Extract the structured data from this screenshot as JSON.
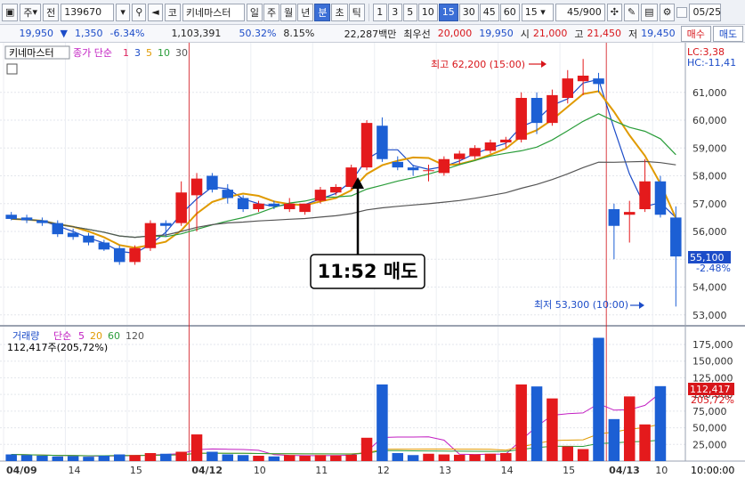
{
  "toolbar": {
    "market_select": "주",
    "prev_label": "전",
    "code": "139670",
    "exchange_label": "코",
    "stock_name": "키네마스터",
    "periods": [
      "일",
      "주",
      "월",
      "년",
      "분",
      "초",
      "틱"
    ],
    "active_period": "분",
    "intervals": [
      "1",
      "3",
      "5",
      "10",
      "15",
      "30",
      "45",
      "60"
    ],
    "active_interval": "15",
    "interval_select": "15",
    "count": "45/900",
    "date": "05/25"
  },
  "quote": {
    "price": "19,950",
    "change": "1,350",
    "change_pct": "-6.34%",
    "volume": "1,103,391",
    "vol_ratio": "50.32%",
    "turnover": "8.15%",
    "amount": "22,287백만",
    "pref_label": "최우선",
    "ask": "20,000",
    "bid": "19,950",
    "open_label": "시",
    "open": "21,000",
    "high_label": "고",
    "high": "21,450",
    "low_label": "저",
    "low": "19,450",
    "buy_button": "매수",
    "sell_button": "매도"
  },
  "price_panel": {
    "stock_label": "키네마스터",
    "ma_title": "종가 단순",
    "ma_periods": [
      "1",
      "3",
      "5",
      "10",
      "30"
    ],
    "ma_colors": [
      "#e0245e",
      "#1c4cc8",
      "#e09a00",
      "#2a9d3a",
      "#555555"
    ],
    "lc_label": "LC:3,38",
    "hc_label": "HC:-11,41",
    "high_annot": "최고 62,200 (15:00)",
    "low_annot": "최저 53,300 (10:00)",
    "callout": "11:52 매도",
    "current_price_tag": "55,100",
    "current_pct_tag": "-2.48%",
    "y_ticks": [
      "61,000",
      "60,000",
      "59,000",
      "58,000",
      "57,000",
      "56,000",
      "54,000",
      "53,000"
    ]
  },
  "volume_panel": {
    "title": "거래량",
    "ma_title": "단순",
    "ma_periods": [
      "5",
      "20",
      "60",
      "120"
    ],
    "ma_colors": [
      "#c21ec2",
      "#e09a00",
      "#2a9d3a",
      "#555555"
    ],
    "info": "112,417주(205,72%)",
    "current_tag": "112,417",
    "current_pct": "205,72%",
    "y_ticks": [
      "175,000",
      "150,000",
      "125,000",
      "100,000",
      "75,000",
      "50,000",
      "25,000"
    ]
  },
  "x_axis": {
    "labels": [
      "04/09",
      "14",
      "15",
      "04/12",
      "10",
      "11",
      "12",
      "13",
      "14",
      "15",
      "04/13",
      "10"
    ],
    "corner": "10:00:00"
  },
  "chart_data": {
    "type": "candlestick",
    "price_range": [
      52800,
      62400
    ],
    "volume_range": [
      0,
      195000
    ],
    "candles": [
      {
        "o": 56600,
        "h": 56700,
        "l": 56400,
        "c": 56450
      },
      {
        "o": 56500,
        "h": 56600,
        "l": 56300,
        "c": 56400
      },
      {
        "o": 56400,
        "h": 56500,
        "l": 56200,
        "c": 56300
      },
      {
        "o": 56300,
        "h": 56400,
        "l": 55800,
        "c": 55900
      },
      {
        "o": 55950,
        "h": 56100,
        "l": 55700,
        "c": 55800
      },
      {
        "o": 55850,
        "h": 55950,
        "l": 55500,
        "c": 55600
      },
      {
        "o": 55600,
        "h": 55700,
        "l": 55300,
        "c": 55350
      },
      {
        "o": 55400,
        "h": 55500,
        "l": 54800,
        "c": 54900
      },
      {
        "o": 54900,
        "h": 55500,
        "l": 54800,
        "c": 55400
      },
      {
        "o": 55400,
        "h": 56400,
        "l": 55300,
        "c": 56300
      },
      {
        "o": 56300,
        "h": 56400,
        "l": 55800,
        "c": 56200
      },
      {
        "o": 56300,
        "h": 57800,
        "l": 56200,
        "c": 57400
      },
      {
        "o": 57300,
        "h": 58100,
        "l": 56000,
        "c": 57900
      },
      {
        "o": 58000,
        "h": 58100,
        "l": 57400,
        "c": 57500
      },
      {
        "o": 57500,
        "h": 57700,
        "l": 57000,
        "c": 57200
      },
      {
        "o": 57200,
        "h": 57300,
        "l": 56700,
        "c": 56800
      },
      {
        "o": 56800,
        "h": 57100,
        "l": 56700,
        "c": 57000
      },
      {
        "o": 57000,
        "h": 57100,
        "l": 56800,
        "c": 56900
      },
      {
        "o": 56800,
        "h": 57200,
        "l": 56700,
        "c": 57000
      },
      {
        "o": 56700,
        "h": 57000,
        "l": 56600,
        "c": 57000
      },
      {
        "o": 57100,
        "h": 57600,
        "l": 57000,
        "c": 57500
      },
      {
        "o": 57400,
        "h": 57700,
        "l": 57300,
        "c": 57600
      },
      {
        "o": 57600,
        "h": 58400,
        "l": 57500,
        "c": 58300
      },
      {
        "o": 58300,
        "h": 60000,
        "l": 58200,
        "c": 59900
      },
      {
        "o": 59800,
        "h": 60100,
        "l": 58500,
        "c": 58600
      },
      {
        "o": 58500,
        "h": 58700,
        "l": 58200,
        "c": 58300
      },
      {
        "o": 58300,
        "h": 58400,
        "l": 58000,
        "c": 58200
      },
      {
        "o": 58200,
        "h": 58400,
        "l": 57800,
        "c": 58200
      },
      {
        "o": 58100,
        "h": 58700,
        "l": 58000,
        "c": 58600
      },
      {
        "o": 58600,
        "h": 58900,
        "l": 58400,
        "c": 58800
      },
      {
        "o": 58700,
        "h": 59100,
        "l": 58600,
        "c": 59000
      },
      {
        "o": 58900,
        "h": 59300,
        "l": 58800,
        "c": 59200
      },
      {
        "o": 59200,
        "h": 59400,
        "l": 59000,
        "c": 59300
      },
      {
        "o": 59300,
        "h": 61000,
        "l": 59200,
        "c": 60800
      },
      {
        "o": 60800,
        "h": 61000,
        "l": 59500,
        "c": 59900
      },
      {
        "o": 59900,
        "h": 61100,
        "l": 59800,
        "c": 60900
      },
      {
        "o": 60800,
        "h": 61800,
        "l": 60600,
        "c": 61500
      },
      {
        "o": 61400,
        "h": 62200,
        "l": 60900,
        "c": 61600
      },
      {
        "o": 61500,
        "h": 61700,
        "l": 61000,
        "c": 61300
      },
      {
        "o": 56800,
        "h": 57000,
        "l": 55000,
        "c": 56200
      },
      {
        "o": 56600,
        "h": 57100,
        "l": 55600,
        "c": 56700
      },
      {
        "o": 56800,
        "h": 58600,
        "l": 56700,
        "c": 57800
      },
      {
        "o": 57800,
        "h": 58000,
        "l": 56500,
        "c": 56600
      },
      {
        "o": 56500,
        "h": 56900,
        "l": 53300,
        "c": 55100
      }
    ],
    "volumes": [
      10000,
      9000,
      8000,
      7000,
      7500,
      6500,
      8000,
      10000,
      9000,
      12000,
      11000,
      14000,
      40000,
      14000,
      10000,
      9000,
      8000,
      7000,
      9000,
      8000,
      9000,
      8500,
      9500,
      35000,
      115000,
      12000,
      9000,
      11000,
      10000,
      9500,
      10000,
      11000,
      12000,
      115000,
      112000,
      94000,
      22000,
      18000,
      185000,
      63000,
      97000,
      55000,
      112417
    ]
  }
}
